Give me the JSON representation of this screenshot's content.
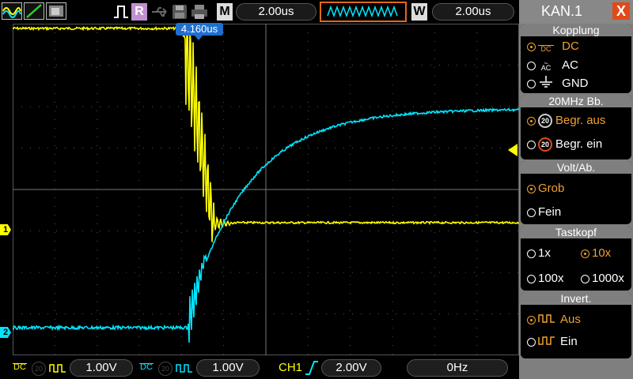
{
  "toolbar": {
    "run_label": "R",
    "m_label": "M",
    "timebase": "2.00us",
    "w_label": "W",
    "window_timebase": "2.00us"
  },
  "trigger_marker": {
    "label": "4.160us"
  },
  "channels": {
    "ch1": {
      "marker": "1",
      "color": "#ffff00"
    },
    "ch2": {
      "marker": "2",
      "color": "#00e5ff"
    }
  },
  "bottom": {
    "ch1_coupling": "DC",
    "ch1_bw": "20",
    "ch1_scale": "1.00V",
    "ch2_coupling": "DC",
    "ch2_bw": "20",
    "ch2_scale": "1.00V",
    "trigger_source": "CH1",
    "trigger_level": "2.00V",
    "frequency": "0Hz"
  },
  "menu": {
    "title": "KAN.1",
    "close": "X",
    "kopplung": {
      "title": "Kopplung",
      "options": [
        {
          "label": "DC",
          "icon": "DC",
          "selected": true
        },
        {
          "label": "AC",
          "icon": "AC",
          "selected": false
        },
        {
          "label": "GND",
          "icon": "",
          "selected": false
        }
      ]
    },
    "bandwidth": {
      "title": "20MHz  Bb.",
      "options": [
        {
          "label": "Begr.  aus",
          "icon": "20",
          "selected": true
        },
        {
          "label": "Begr.  ein",
          "icon": "20",
          "selected": false
        }
      ]
    },
    "volt": {
      "title": "Volt/Ab.",
      "options": [
        {
          "label": "Grob",
          "selected": true
        },
        {
          "label": "Fein",
          "selected": false
        }
      ]
    },
    "tastkopf": {
      "title": "Tastkopf",
      "options": [
        {
          "label": "1x",
          "selected": false
        },
        {
          "label": "10x",
          "selected": true
        },
        {
          "label": "100x",
          "selected": false
        },
        {
          "label": "1000x",
          "selected": false
        }
      ]
    },
    "invert": {
      "title": "Invert.",
      "options": [
        {
          "label": "Aus",
          "selected": true
        },
        {
          "label": "Ein",
          "selected": false
        }
      ]
    }
  },
  "colors": {
    "ch1": "#ffff00",
    "ch2": "#00e5ff",
    "accent": "#f0a030",
    "menu_bg": "#7f7f7f"
  }
}
